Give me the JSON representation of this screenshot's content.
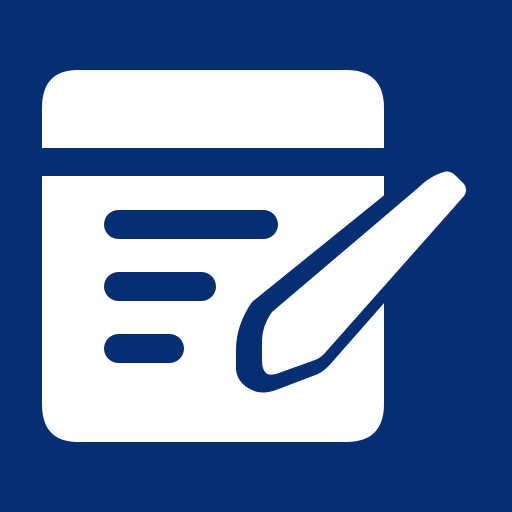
{
  "app_icon": {
    "name": "notes-edit-icon",
    "description_visible_text": ""
  },
  "colors": {
    "background": "#062E73",
    "foreground": "#FFFFFF"
  }
}
